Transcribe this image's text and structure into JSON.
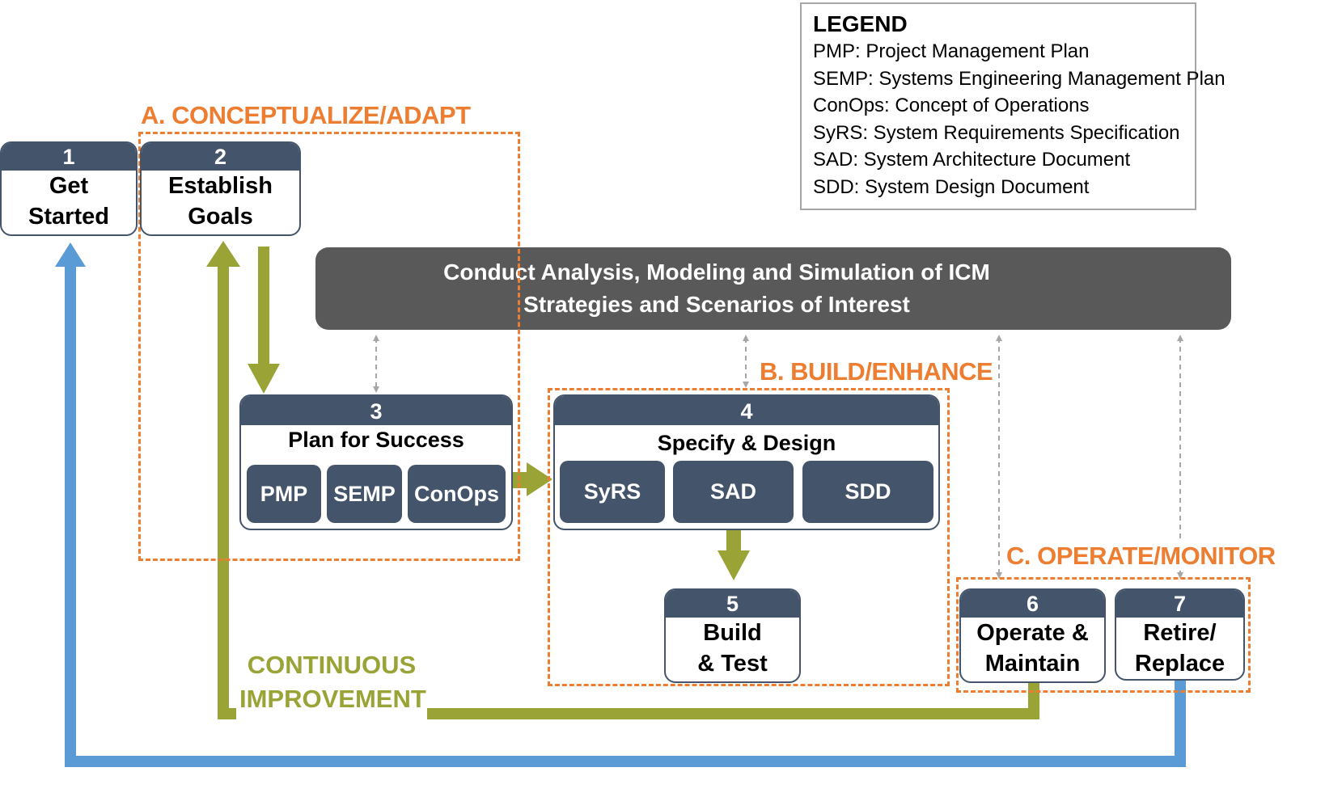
{
  "colors": {
    "step_header": "#44546a",
    "phase_orange": "#ed7d31",
    "flow_green": "#9aa436",
    "return_blue": "#5b9bd5",
    "banner_gray": "#595959",
    "dotted_gray": "#a6a6a6"
  },
  "legend": {
    "title": "LEGEND",
    "items": [
      "PMP: Project Management Plan",
      "SEMP: Systems Engineering Management Plan",
      "ConOps: Concept of Operations",
      "SyRS: System Requirements Specification",
      "SAD: System Architecture Document",
      "SDD: System Design Document"
    ]
  },
  "phases": {
    "a": "A. CONCEPTUALIZE/ADAPT",
    "b": "B. BUILD/ENHANCE",
    "c": "C. OPERATE/MONITOR"
  },
  "banner": {
    "line1": "Conduct Analysis, Modeling and Simulation of ICM",
    "line2": "Strategies and Scenarios of Interest"
  },
  "steps": [
    {
      "number": "1",
      "line1": "Get",
      "line2": "Started"
    },
    {
      "number": "2",
      "line1": "Establish",
      "line2": "Goals"
    },
    {
      "number": "3",
      "title": "Plan for Success",
      "docs": [
        "PMP",
        "SEMP",
        "ConOps"
      ]
    },
    {
      "number": "4",
      "title": "Specify & Design",
      "docs": [
        "SyRS",
        "SAD",
        "SDD"
      ]
    },
    {
      "number": "5",
      "line1": "Build",
      "line2": "& Test"
    },
    {
      "number": "6",
      "line1": "Operate &",
      "line2": "Maintain"
    },
    {
      "number": "7",
      "line1": "Retire/",
      "line2": "Replace"
    }
  ],
  "continuous_improvement": {
    "line1": "CONTINUOUS",
    "line2": "IMPROVEMENT"
  }
}
